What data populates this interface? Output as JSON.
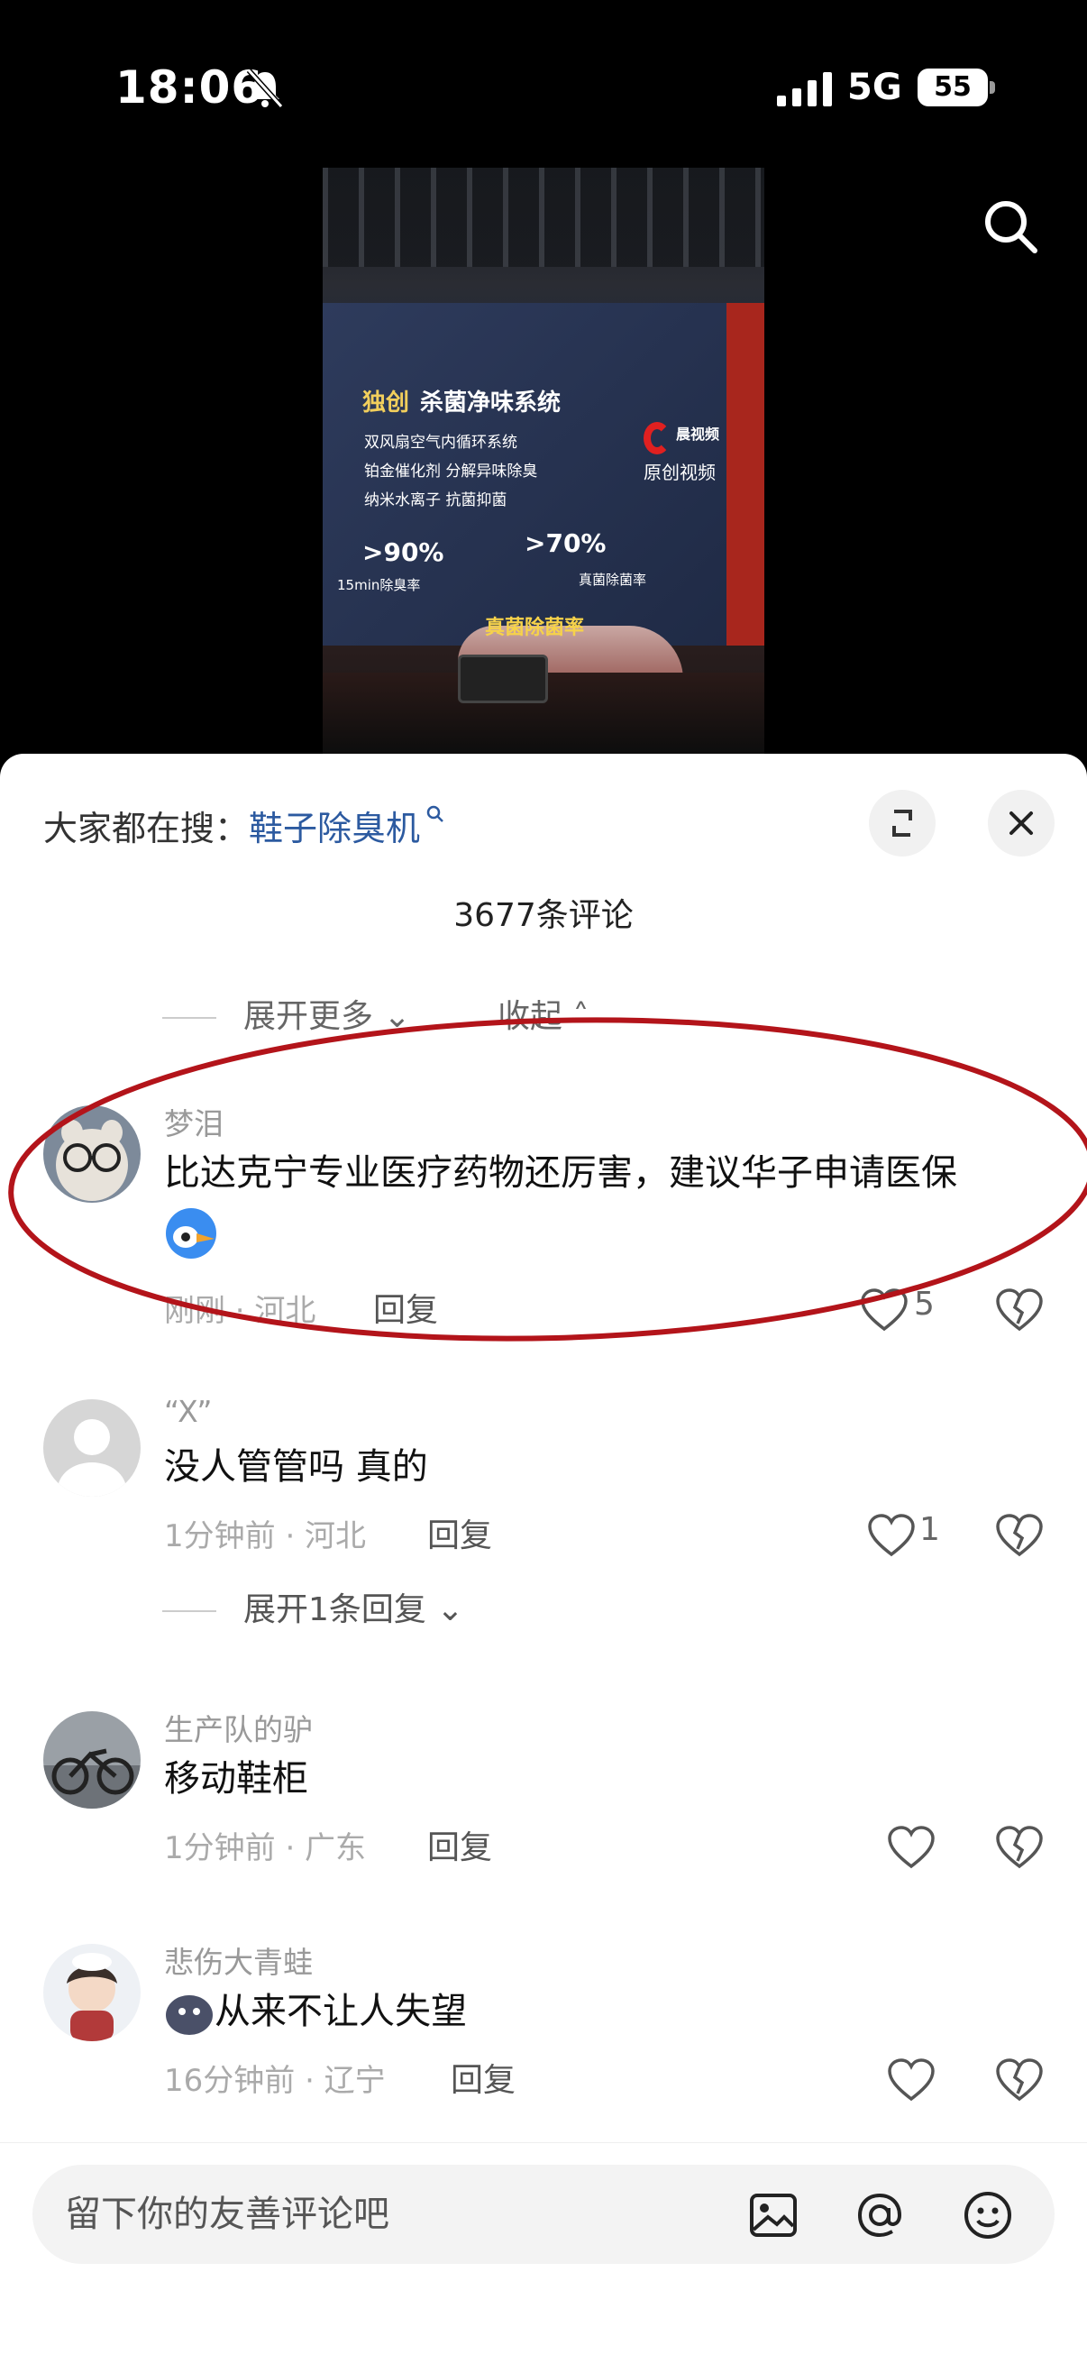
{
  "status_bar": {
    "time": "18:06",
    "network": "5G",
    "battery": "55"
  },
  "video": {
    "headline_gold": "独创",
    "headline_white": "杀菌净味系统",
    "lines": [
      "双风扇空气内循环系统",
      "铂金催化剂 分解异味除臭",
      "纳米水离子 抗菌抑菌"
    ],
    "stat1": ">90%",
    "stat1_sub": "15min除臭率",
    "stat2": ">70%",
    "stat2_sub": "真菌除菌率",
    "yellow_label": "真菌除菌率",
    "watermark_top": "晨视频",
    "watermark_bottom": "原创视频"
  },
  "sheet": {
    "hot_search_prefix": "大家都在搜：",
    "hot_search_term": "鞋子除臭机",
    "comment_count": "3677条评论",
    "expand_more": "展开更多",
    "collapse": "收起"
  },
  "comments": [
    {
      "username": "梦泪",
      "text": "比达克宁专业医疗药物还厉害，建议华子申请医保",
      "time_loc": "刚刚 · 河北",
      "reply": "回复",
      "likes": "5"
    },
    {
      "username": "“X”",
      "text": "没人管管吗  真的",
      "time_loc": "1分钟前 · 河北",
      "reply": "回复",
      "likes": "1",
      "expand_replies": "展开1条回复"
    },
    {
      "username": "生产队的驴",
      "text": "移动鞋柜",
      "time_loc": "1分钟前 · 广东",
      "reply": "回复"
    },
    {
      "username": "悲伤大青蛙",
      "text": "从来不让人失望",
      "time_loc": "16分钟前 · 辽宁",
      "reply": "回复"
    }
  ],
  "input": {
    "placeholder": "留下你的友善评论吧"
  }
}
